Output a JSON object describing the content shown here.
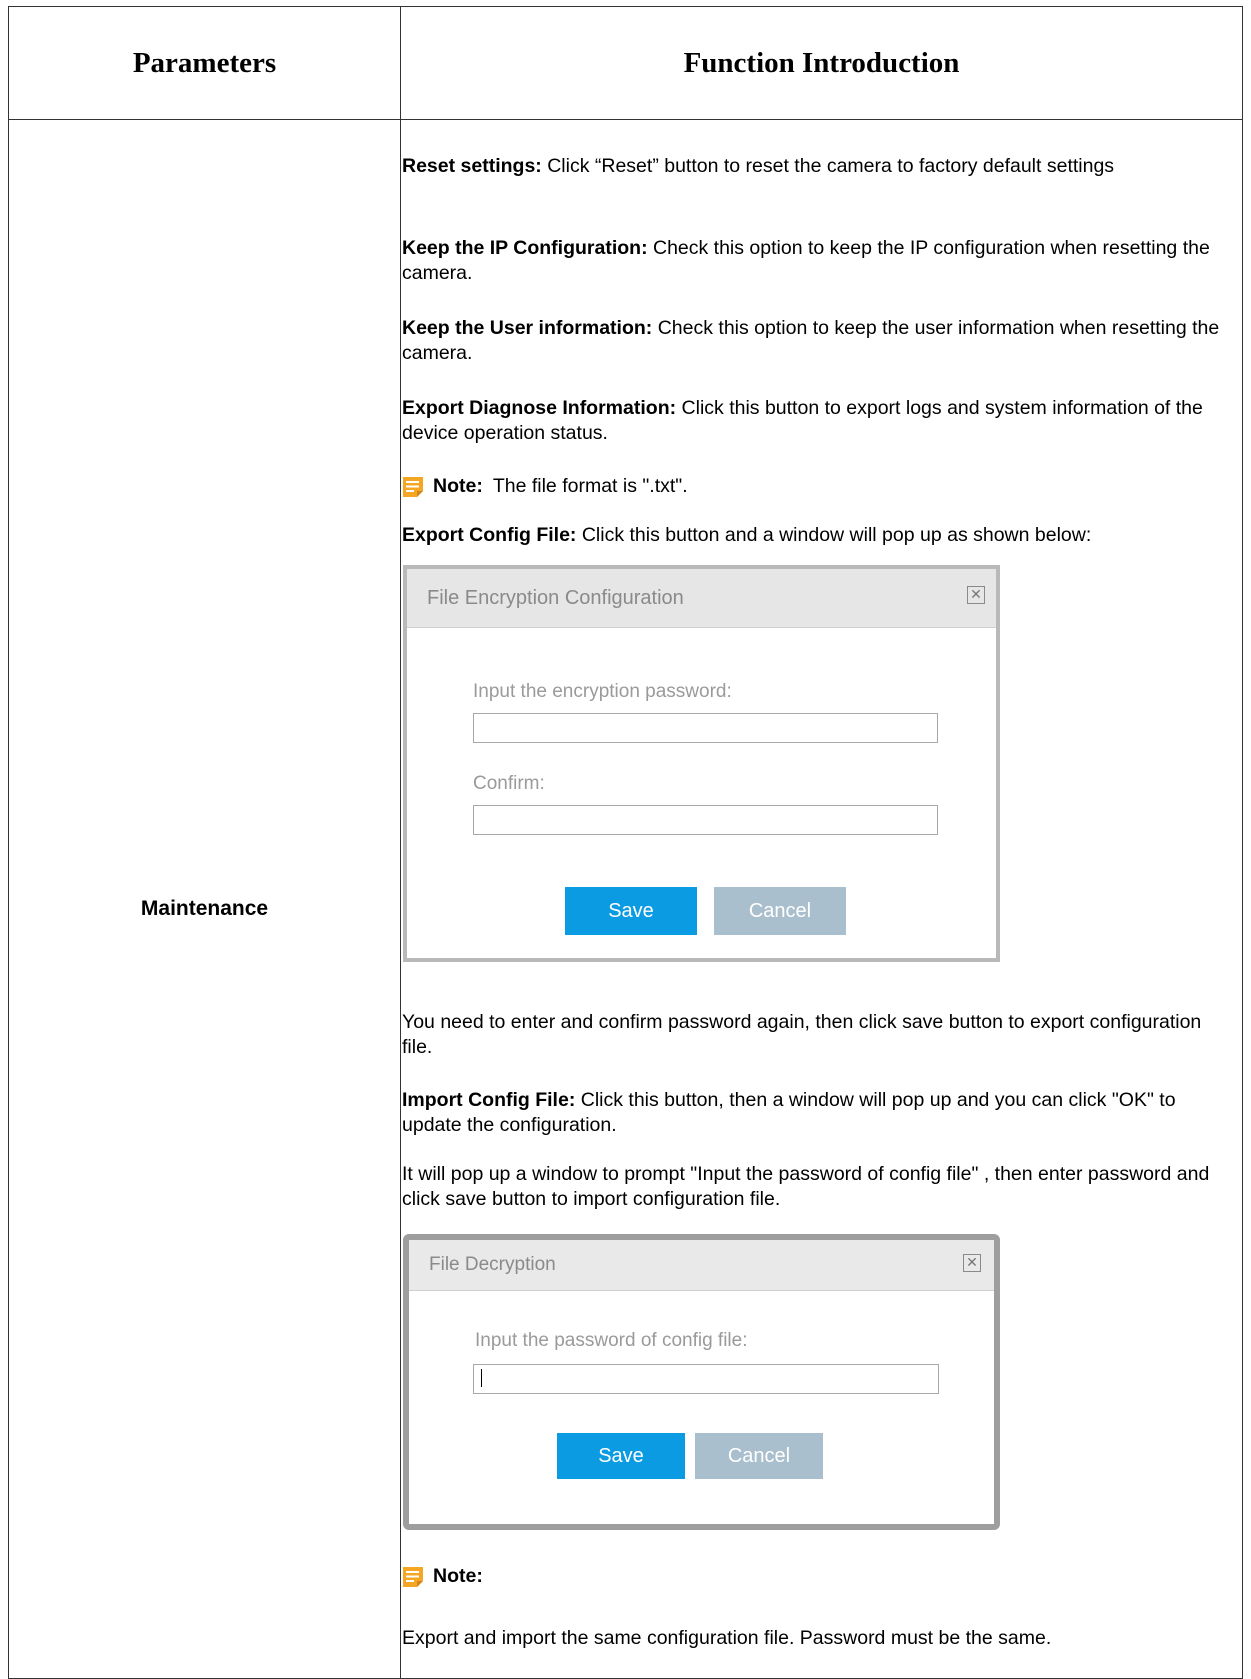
{
  "table": {
    "header_parameters": "Parameters",
    "header_function": "Function Introduction",
    "parameter_name": "Maintenance"
  },
  "content": {
    "reset_label": "Reset settings:",
    "reset_text": " Click “Reset” button to reset the camera to factory default settings",
    "keep_ip_label": "Keep the IP Configuration:",
    "keep_ip_text": " Check this option to keep the IP configuration when resetting the camera.",
    "keep_user_label": "Keep the User information:",
    "keep_user_text": " Check this option to keep the user information when resetting the camera.",
    "export_diag_label": "Export Diagnose Information:",
    "export_diag_text": " Click this button to export logs and system information of the device operation status.",
    "note1_label": "Note:",
    "note1_text": "The file format is \".txt\".",
    "export_config_label": "Export Config File:",
    "export_config_text": " Click this button and a window will pop up as shown below:",
    "after_dialog1": "You need to enter and confirm password again, then click save button to export configuration file.",
    "import_config_label": "Import Config File:",
    "import_config_text": " Click this button, then a window will pop up and you can click \"OK\" to update the configuration.",
    "import_prompt": "It will pop up a window to prompt \"Input the password of config file\" , then enter password and click save button to import configuration file.",
    "note2_label": "Note:",
    "note2_text": "Export and import the same configuration file. Password must be the same."
  },
  "dialog_encrypt": {
    "title": "File Encryption Configuration",
    "password_label": "Input the encryption password:",
    "password_value": "",
    "confirm_label": "Confirm:",
    "confirm_value": "",
    "save_label": "Save",
    "cancel_label": "Cancel"
  },
  "dialog_decrypt": {
    "title": "File Decryption",
    "password_label": "Input the password of config file:",
    "password_value": "",
    "save_label": "Save",
    "cancel_label": "Cancel"
  },
  "colors": {
    "save_button": "#0a9be3",
    "cancel_button": "#a9bfcd",
    "note_icon": "#f5a623"
  }
}
